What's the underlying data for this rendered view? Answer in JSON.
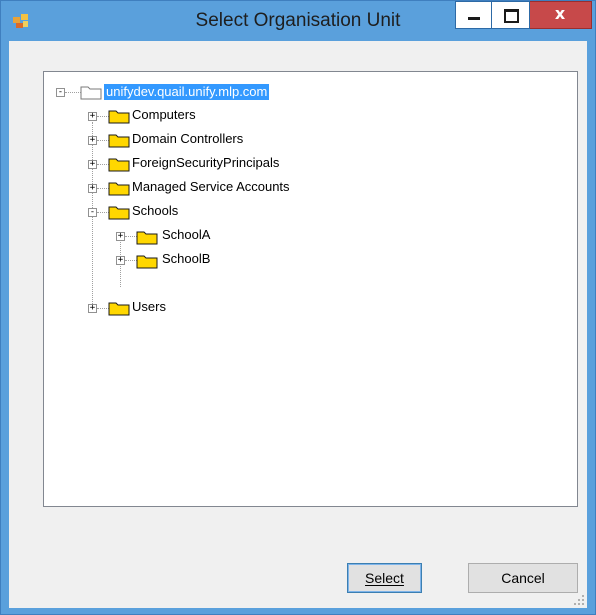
{
  "window": {
    "title": "Select Organisation Unit",
    "close_glyph": "x",
    "icon": "windows-app-icon"
  },
  "tree": {
    "root": {
      "label": "unifydev.quail.unify.mlp.com",
      "expanded": true,
      "selected": true
    },
    "items": [
      {
        "label": "Computers",
        "expander": "+"
      },
      {
        "label": "Domain Controllers",
        "expander": "+"
      },
      {
        "label": "ForeignSecurityPrincipals",
        "expander": "+"
      },
      {
        "label": "Managed Service Accounts",
        "expander": "+"
      },
      {
        "label": "Schools",
        "expander": "-"
      },
      {
        "label": "SchoolA",
        "expander": "+"
      },
      {
        "label": "SchoolB",
        "expander": "+"
      },
      {
        "label": "Users",
        "expander": "+"
      }
    ]
  },
  "buttons": {
    "select_label": "Select",
    "cancel_label": "Cancel"
  },
  "colors": {
    "titlebar": "#5aa0dc",
    "selection": "#3399ff",
    "folder": "#ffd700",
    "close": "#c7494a"
  }
}
